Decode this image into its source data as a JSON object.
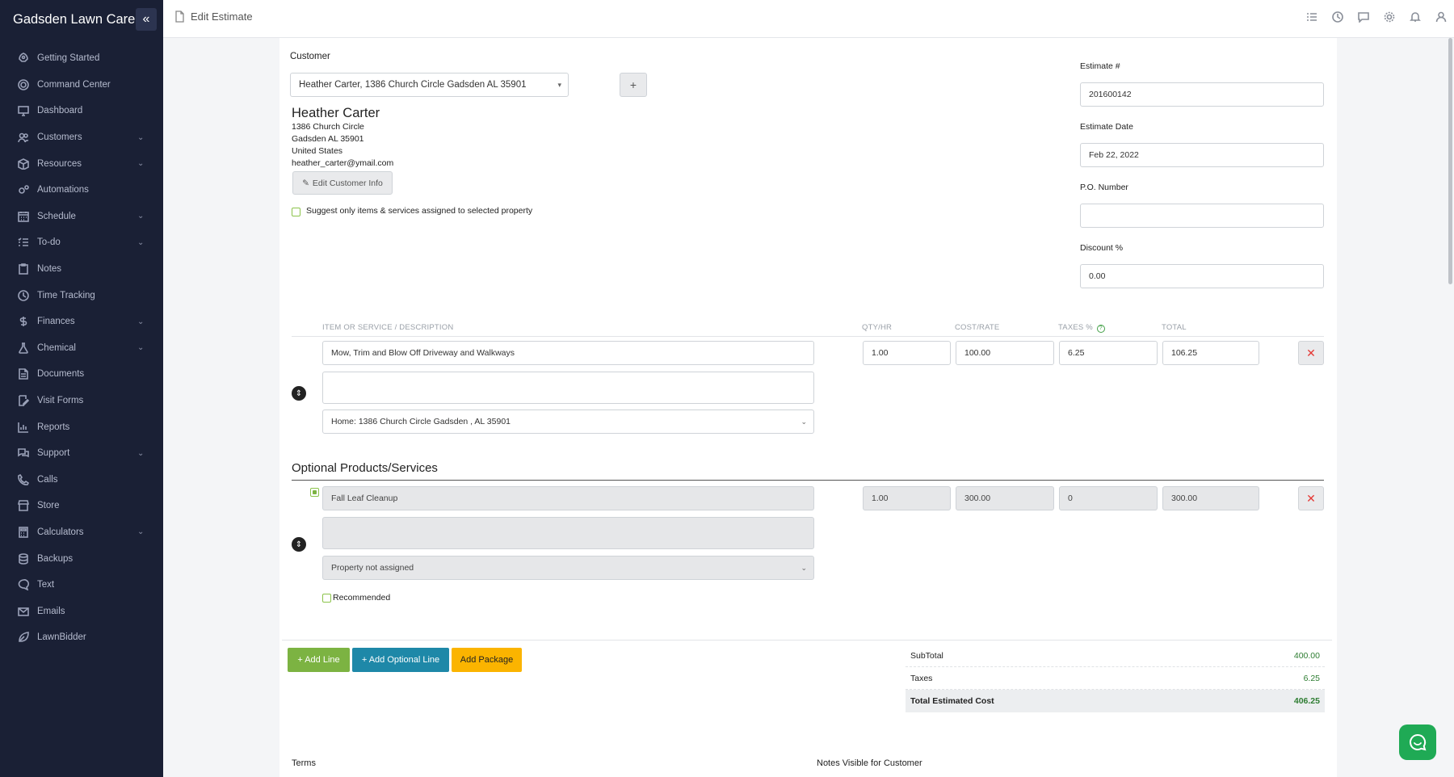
{
  "app": {
    "brand": "Gadsden Lawn Care",
    "page_title": "Edit Estimate"
  },
  "sidebar": {
    "items": [
      {
        "label": "Getting Started",
        "icon": "rocket-icon",
        "has_children": false
      },
      {
        "label": "Command Center",
        "icon": "target-icon",
        "has_children": false
      },
      {
        "label": "Dashboard",
        "icon": "monitor-icon",
        "has_children": false
      },
      {
        "label": "Customers",
        "icon": "users-icon",
        "has_children": true
      },
      {
        "label": "Resources",
        "icon": "box-icon",
        "has_children": true
      },
      {
        "label": "Automations",
        "icon": "gears-icon",
        "has_children": false
      },
      {
        "label": "Schedule",
        "icon": "calendar-icon",
        "has_children": true
      },
      {
        "label": "To-do",
        "icon": "list-check-icon",
        "has_children": true
      },
      {
        "label": "Notes",
        "icon": "clipboard-icon",
        "has_children": false
      },
      {
        "label": "Time Tracking",
        "icon": "clock-icon",
        "has_children": false
      },
      {
        "label": "Finances",
        "icon": "dollar-icon",
        "has_children": true
      },
      {
        "label": "Chemical",
        "icon": "flask-icon",
        "has_children": true
      },
      {
        "label": "Documents",
        "icon": "document-icon",
        "has_children": false
      },
      {
        "label": "Visit Forms",
        "icon": "form-edit-icon",
        "has_children": false
      },
      {
        "label": "Reports",
        "icon": "bar-chart-icon",
        "has_children": false
      },
      {
        "label": "Support",
        "icon": "chat-bubbles-icon",
        "has_children": true
      },
      {
        "label": "Calls",
        "icon": "phone-icon",
        "has_children": false
      },
      {
        "label": "Store",
        "icon": "store-icon",
        "has_children": false
      },
      {
        "label": "Calculators",
        "icon": "calculator-icon",
        "has_children": true
      },
      {
        "label": "Backups",
        "icon": "database-icon",
        "has_children": false
      },
      {
        "label": "Text",
        "icon": "message-icon",
        "has_children": false
      },
      {
        "label": "Emails",
        "icon": "envelope-icon",
        "has_children": false
      },
      {
        "label": "LawnBidder",
        "icon": "leaf-icon",
        "has_children": false
      }
    ]
  },
  "topbar": {
    "icons": [
      "task-list-icon",
      "clock-icon",
      "chat-icon",
      "gear-icon",
      "bell-icon",
      "user-icon"
    ]
  },
  "customer": {
    "label": "Customer",
    "selected": "Heather Carter, 1386 Church Circle Gadsden AL 35901",
    "add_button": "+",
    "name": "Heather Carter",
    "address1": "1386 Church Circle",
    "address2": "Gadsden AL 35901",
    "country": "United States",
    "email": "heather_carter@ymail.com",
    "edit_button": "Edit Customer Info",
    "suggest_label": "Suggest only items & services assigned to selected property"
  },
  "estimate": {
    "number_label": "Estimate #",
    "number": "201600142",
    "date_label": "Estimate Date",
    "date": "Feb 22, 2022",
    "po_label": "P.O. Number",
    "po": "",
    "discount_label": "Discount %",
    "discount": "0.00"
  },
  "table": {
    "headers": {
      "item": "ITEM OR SERVICE / DESCRIPTION",
      "qty": "QTY/HR",
      "cost": "COST/RATE",
      "taxes": "TAXES %",
      "total": "TOTAL"
    },
    "line": {
      "item": "Mow, Trim and Blow Off Driveway and Walkways",
      "qty": "1.00",
      "cost": "100.00",
      "taxes": "6.25",
      "total": "106.25",
      "description": "",
      "property": "Home: 1386 Church Circle Gadsden , AL 35901"
    }
  },
  "optional": {
    "heading": "Optional Products/Services",
    "line": {
      "item": "Fall Leaf Cleanup",
      "qty": "1.00",
      "cost": "300.00",
      "taxes": "0",
      "total": "300.00",
      "description": "",
      "property": "Property not assigned",
      "recommended_label": "Recommended"
    }
  },
  "actions": {
    "add_line": "+ Add Line",
    "add_optional": "+ Add Optional Line",
    "add_package": "Add Package"
  },
  "summary": {
    "subtotal_label": "SubTotal",
    "subtotal": "400.00",
    "taxes_label": "Taxes",
    "taxes": "6.25",
    "total_label": "Total Estimated Cost",
    "total": "406.25"
  },
  "footer": {
    "terms_label": "Terms",
    "notes_label": "Notes Visible for Customer"
  },
  "colors": {
    "sidebar_bg": "#1a2035",
    "green": "#7cb342",
    "teal": "#1e88a8",
    "amber": "#fbb400",
    "chat": "#1faa55",
    "delete": "#e53935"
  }
}
